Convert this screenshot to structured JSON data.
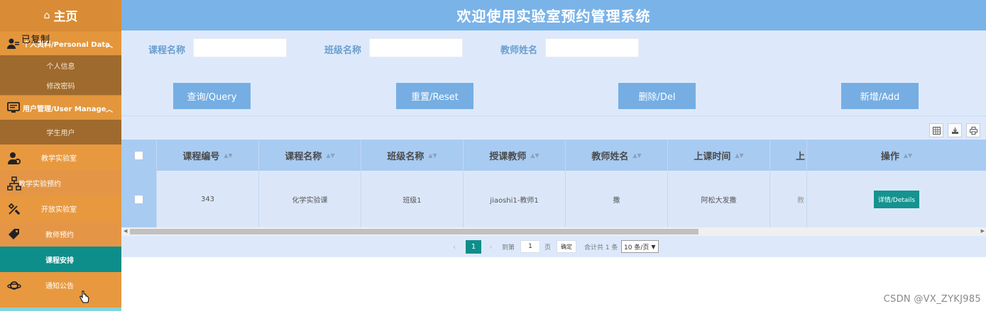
{
  "sidebar": {
    "home_label": "主页",
    "toast": "已复制",
    "sections": {
      "personal": "个人资料/Personal Data",
      "user_manage": "用户管理/User Manage"
    },
    "personal_items": [
      "个人信息",
      "修改密码"
    ],
    "user_items": [
      "学生用户"
    ],
    "items": [
      {
        "label": "教学实验室",
        "icon": "person-gear-icon"
      },
      {
        "label": "教学实验预约",
        "icon": "sitemap-icon"
      },
      {
        "label": "开放实验室",
        "icon": "tools-icon"
      },
      {
        "label": "教师预约",
        "icon": "tag-icon"
      },
      {
        "label": "课程安排",
        "icon": "",
        "active": true
      },
      {
        "label": "通知公告",
        "icon": "planet-icon"
      }
    ]
  },
  "header": {
    "title": "欢迎使用实验室预约管理系统"
  },
  "search": {
    "course_name_label": "课程名称",
    "class_name_label": "班级名称",
    "teacher_name_label": "教师姓名",
    "course_name_value": "",
    "class_name_value": "",
    "teacher_name_value": ""
  },
  "actions": {
    "query": "查询/Query",
    "reset": "重置/Reset",
    "delete": "删除/Del",
    "add": "新增/Add"
  },
  "table": {
    "columns": [
      "课程编号",
      "课程名称",
      "班级名称",
      "授课教师",
      "教师姓名",
      "上课时间",
      "上",
      "操作"
    ],
    "rows": [
      {
        "course_no": "343",
        "course_name": "化学实验课",
        "class_name": "班级1",
        "teacher": "jiaoshi1-教师1",
        "teacher_name": "撒",
        "time": "阿松大发撒",
        "cut": "教",
        "detail_label": "详情/Details"
      }
    ]
  },
  "pagination": {
    "current_page": "1",
    "goto_label": "到第",
    "goto_value": "1",
    "page_unit": "页",
    "confirm": "确定",
    "total": "合计共 1 条",
    "page_size": "10 条/页"
  },
  "watermark": "CSDN @VX_ZYKJ985",
  "colors": {
    "sidebar": "#e8993f",
    "active": "#0e8e8a",
    "header": "#7ab3e8",
    "panel": "#dde9fb"
  }
}
